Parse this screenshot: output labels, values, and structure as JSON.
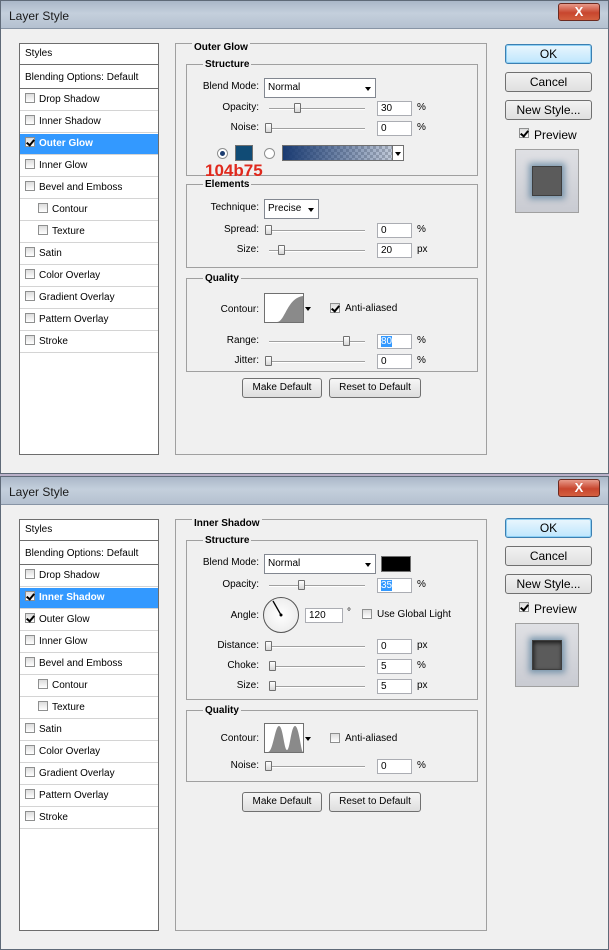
{
  "dialog1": {
    "title": "Layer Style",
    "close": "X",
    "styles_list": {
      "header": "Styles",
      "blending": "Blending Options: Default",
      "items": [
        {
          "label": "Drop Shadow",
          "checked": false
        },
        {
          "label": "Inner Shadow",
          "checked": false
        },
        {
          "label": "Outer Glow",
          "checked": true,
          "selected": true
        },
        {
          "label": "Inner Glow",
          "checked": false
        },
        {
          "label": "Bevel and Emboss",
          "checked": false
        },
        {
          "label": "Contour",
          "checked": false,
          "sub": true
        },
        {
          "label": "Texture",
          "checked": false,
          "sub": true
        },
        {
          "label": "Satin",
          "checked": false
        },
        {
          "label": "Color Overlay",
          "checked": false
        },
        {
          "label": "Gradient Overlay",
          "checked": false
        },
        {
          "label": "Pattern Overlay",
          "checked": false
        },
        {
          "label": "Stroke",
          "checked": false
        }
      ]
    },
    "section_title": "Outer Glow",
    "structure": {
      "title": "Structure",
      "blend_mode_label": "Blend Mode:",
      "blend_mode": "Normal",
      "opacity_label": "Opacity:",
      "opacity": "30",
      "opacity_unit": "%",
      "noise_label": "Noise:",
      "noise": "0",
      "noise_unit": "%",
      "color": "#104b75"
    },
    "annotation": "104b75",
    "elements": {
      "title": "Elements",
      "technique_label": "Technique:",
      "technique": "Precise",
      "spread_label": "Spread:",
      "spread": "0",
      "spread_unit": "%",
      "size_label": "Size:",
      "size": "20",
      "size_unit": "px"
    },
    "quality": {
      "title": "Quality",
      "contour_label": "Contour:",
      "anti_aliased": "Anti-aliased",
      "range_label": "Range:",
      "range": "80",
      "range_unit": "%",
      "jitter_label": "Jitter:",
      "jitter": "0",
      "jitter_unit": "%"
    },
    "make_default": "Make Default",
    "reset_default": "Reset to Default",
    "ok": "OK",
    "cancel": "Cancel",
    "new_style": "New Style...",
    "preview": "Preview"
  },
  "dialog2": {
    "title": "Layer Style",
    "close": "X",
    "styles_list": {
      "header": "Styles",
      "blending": "Blending Options: Default",
      "items": [
        {
          "label": "Drop Shadow",
          "checked": false
        },
        {
          "label": "Inner Shadow",
          "checked": true,
          "selected": true
        },
        {
          "label": "Outer Glow",
          "checked": true
        },
        {
          "label": "Inner Glow",
          "checked": false
        },
        {
          "label": "Bevel and Emboss",
          "checked": false
        },
        {
          "label": "Contour",
          "checked": false,
          "sub": true
        },
        {
          "label": "Texture",
          "checked": false,
          "sub": true
        },
        {
          "label": "Satin",
          "checked": false
        },
        {
          "label": "Color Overlay",
          "checked": false
        },
        {
          "label": "Gradient Overlay",
          "checked": false
        },
        {
          "label": "Pattern Overlay",
          "checked": false
        },
        {
          "label": "Stroke",
          "checked": false
        }
      ]
    },
    "section_title": "Inner Shadow",
    "structure": {
      "title": "Structure",
      "blend_mode_label": "Blend Mode:",
      "blend_mode": "Normal",
      "opacity_label": "Opacity:",
      "opacity": "35",
      "opacity_unit": "%",
      "angle_label": "Angle:",
      "angle": "120",
      "angle_unit": "°",
      "global_light": "Use Global Light",
      "distance_label": "Distance:",
      "distance": "0",
      "distance_unit": "px",
      "choke_label": "Choke:",
      "choke": "5",
      "choke_unit": "%",
      "size_label": "Size:",
      "size": "5",
      "size_unit": "px",
      "color": "#000000"
    },
    "quality": {
      "title": "Quality",
      "contour_label": "Contour:",
      "anti_aliased": "Anti-aliased",
      "noise_label": "Noise:",
      "noise": "0",
      "noise_unit": "%"
    },
    "make_default": "Make Default",
    "reset_default": "Reset to Default",
    "ok": "OK",
    "cancel": "Cancel",
    "new_style": "New Style...",
    "preview": "Preview"
  }
}
